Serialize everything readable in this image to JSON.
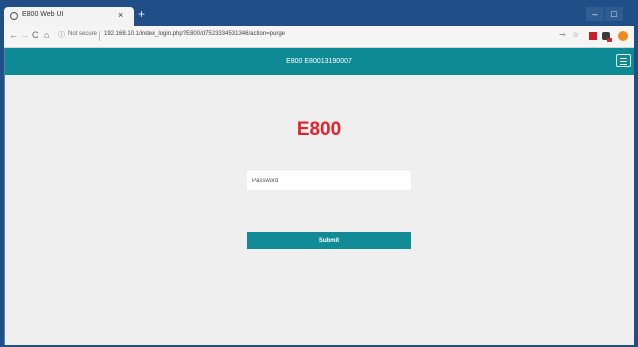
{
  "browser": {
    "tab_title": "E800 Web UI",
    "tab_close": "×",
    "new_tab": "+",
    "window_min": "–",
    "window_max": "□",
    "nav": {
      "back": "←",
      "forward": "→",
      "reload": "C",
      "home": "⌂"
    },
    "security_label": "Not secure",
    "url": "192.168.10.1/index_login.php?E800/d7523334531346/action=purge",
    "icons": [
      "key-icon",
      "star-icon",
      "pdf-extension-icon",
      "toolbox-extension-icon",
      "profile-avatar-icon"
    ],
    "accent_frame_color": "#1f4f86"
  },
  "app": {
    "header_title": "E800 E80013190007",
    "brand": "E800",
    "password_placeholder": "Password",
    "submit_label": "Submit",
    "colors": {
      "header": "#0e8a95",
      "brand": "#e5222a",
      "button": "#118c97"
    }
  }
}
